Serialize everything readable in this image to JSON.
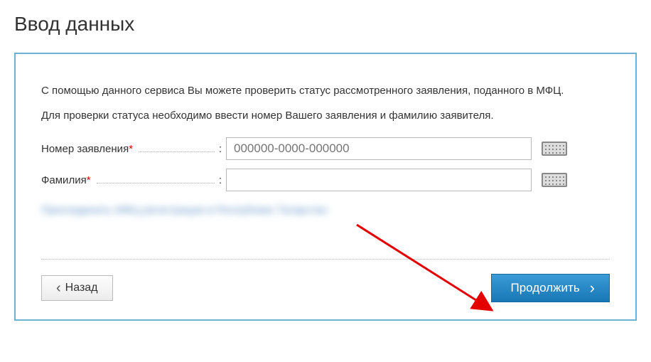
{
  "title": "Ввод данных",
  "intro": "С помощью данного сервиса Вы можете проверить статус рассмотренного заявления, поданного в МФЦ.",
  "sub": "Для проверки статуса необходимо ввести номер Вашего заявления и фамилию заявителя.",
  "form": {
    "application_number": {
      "label": "Номер заявления",
      "placeholder": "000000-0000-000000",
      "value": ""
    },
    "surname": {
      "label": "Фамилия",
      "placeholder": "",
      "value": ""
    }
  },
  "blurred_link": "Присоединить МФЦ регистрации в Республике Татарстан",
  "buttons": {
    "back": "Назад",
    "continue": "Продолжить"
  }
}
